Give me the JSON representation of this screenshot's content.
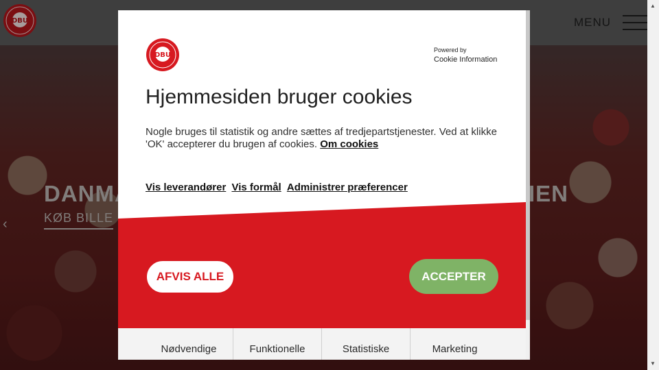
{
  "site": {
    "menu_label": "MENU",
    "hero_title_left": "DANMA",
    "hero_title_right": "IEN",
    "hero_cta": "KØB BILLE"
  },
  "dialog": {
    "powered_by": "Powered by",
    "provider": "Cookie Information",
    "title": "Hjemmesiden bruger cookies",
    "body_text": "Nogle bruges til statistik og andre sættes af tredjepartstjenester. Ved at klikke 'OK' accepterer du brugen af cookies.",
    "about_link": "Om cookies",
    "links": [
      "Vis leverandører",
      "Vis formål",
      "Administrer præferencer"
    ],
    "reject_label": "AFVIS ALLE",
    "accept_label": "ACCEPTER",
    "tabs": [
      "Nødvendige",
      "Funktionelle",
      "Statistiske",
      "Marketing"
    ]
  },
  "colors": {
    "brand_red": "#d71920",
    "accept_green": "#7fb366"
  },
  "icons": {
    "logo": "dbu-logo-icon",
    "menu": "hamburger-menu-icon"
  }
}
